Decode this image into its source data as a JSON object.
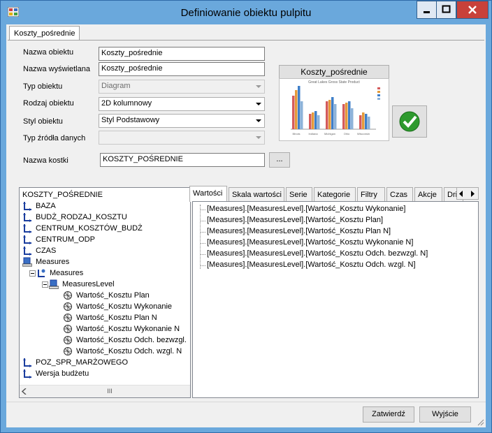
{
  "window": {
    "title": "Definiowanie obiektu pulpitu"
  },
  "main_tab": {
    "label": "Koszty_pośrednie"
  },
  "form": {
    "nazwa_obiektu": {
      "label": "Nazwa obiektu",
      "value": "Koszty_pośrednie"
    },
    "nazwa_wyswietlana": {
      "label": "Nazwa wyświetlana",
      "value": "Koszty_pośrednie"
    },
    "typ_obiektu": {
      "label": "Typ obiektu",
      "value": "Diagram"
    },
    "rodzaj_obiektu": {
      "label": "Rodzaj obiektu",
      "value": "2D kolumnowy"
    },
    "styl_obiektu": {
      "label": "Styl obiektu",
      "value": "Styl Podstawowy"
    },
    "typ_zrodla": {
      "label": "Typ źródła danych",
      "value": ""
    },
    "nazwa_kostki": {
      "label": "Nazwa kostki",
      "value": "KOSZTY_POŚREDNIE",
      "browse_label": "..."
    }
  },
  "preview": {
    "title": "Koszty_pośrednie",
    "chart_title": "Great Lakes Gross State Product",
    "categories": [
      "Illinois",
      "Indiana",
      "Michigan",
      "Ohio",
      "Wisconsin"
    ]
  },
  "tree": {
    "root": "KOSZTY_POŚREDNIE",
    "items": [
      {
        "label": "BAZA"
      },
      {
        "label": "BUDŻ_RODZAJ_KOSZTU"
      },
      {
        "label": "CENTRUM_KOSZTÓW_BUDŻ"
      },
      {
        "label": "CENTRUM_ODP"
      },
      {
        "label": "CZAS"
      },
      {
        "label": "Measures"
      },
      {
        "label": "Measures"
      },
      {
        "label": "MeasuresLevel"
      },
      {
        "label": "Wartość_Kosztu Plan"
      },
      {
        "label": "Wartość_Kosztu Wykonanie"
      },
      {
        "label": "Wartość_Kosztu Plan N"
      },
      {
        "label": "Wartość_Kosztu Wykonanie N"
      },
      {
        "label": "Wartość_Kosztu Odch. bezwzgl."
      },
      {
        "label": "Wartość_Kosztu Odch. wzgl. N"
      },
      {
        "label": "POZ_SPR_MARŻOWEGO"
      },
      {
        "label": "Wersja budżetu"
      }
    ],
    "scroll_grip": "III"
  },
  "tabs": [
    {
      "label": "Wartości"
    },
    {
      "label": "Skala wartości"
    },
    {
      "label": "Serie"
    },
    {
      "label": "Kategorie"
    },
    {
      "label": "Filtry"
    },
    {
      "label": "Czas"
    },
    {
      "label": "Akcje"
    },
    {
      "label": "Dri"
    }
  ],
  "values_list": [
    "[Measures].[MeasuresLevel].[Wartość_Kosztu Wykonanie]",
    "[Measures].[MeasuresLevel].[Wartość_Kosztu Plan]",
    "[Measures].[MeasuresLevel].[Wartość_Kosztu Plan N]",
    "[Measures].[MeasuresLevel].[Wartość_Kosztu Wykonanie N]",
    "[Measures].[MeasuresLevel].[Wartość_Kosztu Odch. bezwzgl. N]",
    "[Measures].[MeasuresLevel].[Wartość_Kosztu Odch. wzgl. N]"
  ],
  "buttons": {
    "confirm": "Zatwierdź",
    "exit": "Wyjście"
  },
  "colors": {
    "titlebar": "#6aa8dc",
    "close": "#c8413a",
    "ok_green": "#2e9a2e"
  }
}
